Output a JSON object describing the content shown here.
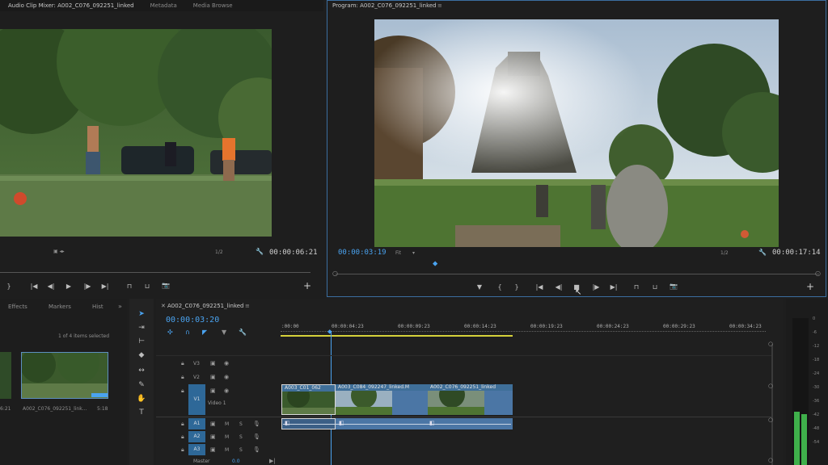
{
  "source_tabs": [
    "Audio Clip Mixer: A002_C076_092251_linked",
    "Metadata",
    "Media Browse"
  ],
  "source": {
    "timecode_end": "00:00:06:21",
    "resolution": "1/2"
  },
  "program": {
    "tab_title": "Program: A002_C076_092251_linked",
    "timecode_current": "00:00:03:19",
    "fit": "Fit",
    "resolution": "1/2",
    "timecode_end": "00:00:17:14"
  },
  "project": {
    "tabs": [
      "Effects",
      "Markers",
      "Hist"
    ],
    "selection_info": "1 of 4 items selected",
    "items": [
      {
        "name": "A002_C076_092251_link...",
        "duration": "5:18"
      }
    ],
    "left_partial_duration": "6:21"
  },
  "timeline": {
    "tab_title": "A002_C076_092251_linked",
    "timecode": "00:00:03:20",
    "ruler": [
      ":00:00",
      "00:00:04:23",
      "00:00:09:23",
      "00:00:14:23",
      "00:00:19:23",
      "00:00:24:23",
      "00:00:29:23",
      "00:00:34:23"
    ],
    "tracks": {
      "v3": "V3",
      "v2": "V2",
      "v1": "V1",
      "video1": "Video 1",
      "a1": "A1",
      "a2": "A2",
      "a3": "A3",
      "master": "Master",
      "master_value": "0.0",
      "m": "M",
      "s": "S"
    },
    "clips": [
      {
        "label": "A003_C01_062"
      },
      {
        "label": "A003_C084_092247_linked.M"
      },
      {
        "label": "A002_C076_092251_linked"
      }
    ]
  },
  "meter": {
    "ticks": [
      "0",
      "-6",
      "-12",
      "-18",
      "-24",
      "-30",
      "-36",
      "-42",
      "-48",
      "-54"
    ]
  },
  "icons": {
    "wrench": "🔧",
    "marker": "▼",
    "in": "{",
    "out": "}",
    "goto_in": "|◀",
    "step_back": "◀|",
    "play": "▶",
    "stop": "■",
    "step_fwd": "|▶",
    "goto_out": "▶|",
    "camera": "📷",
    "plus": "+"
  },
  "colors": {
    "accent": "#4aa3f0",
    "clip_video": "#3f6f99",
    "clip_audio": "#4b76a5",
    "work_area": "#d6d23a",
    "meter_green": "#3fb04b"
  }
}
